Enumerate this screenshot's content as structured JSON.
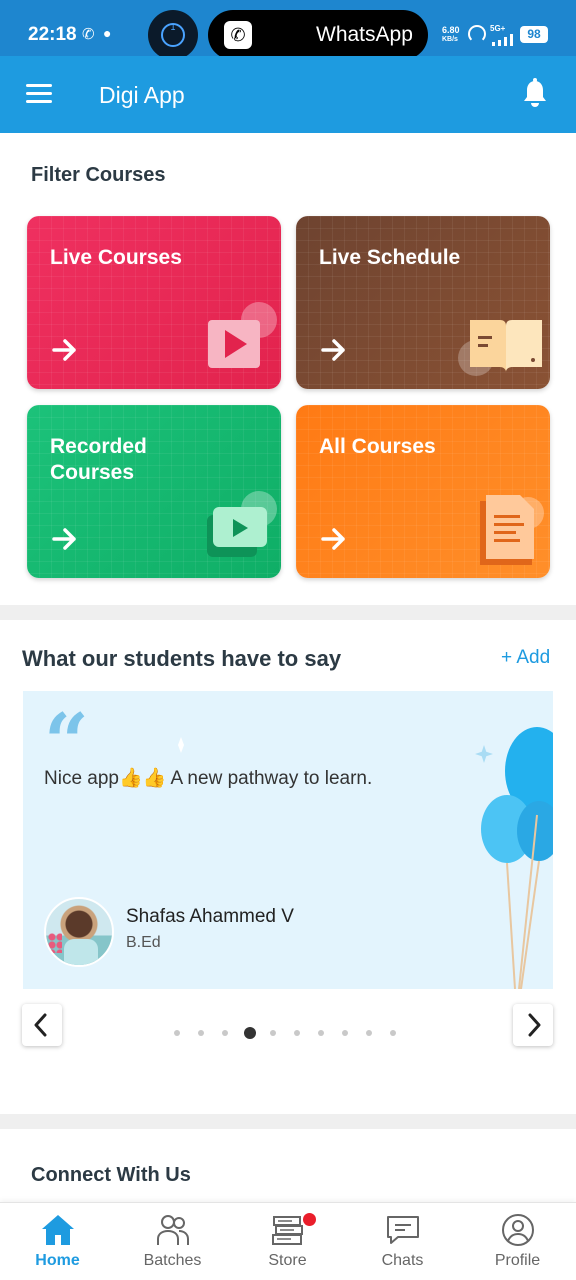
{
  "status_bar": {
    "time": "22:18",
    "call_counter": "1",
    "call_app": "WhatsApp",
    "speed_value": "6.80",
    "speed_unit": "KB/s",
    "network": "5G+",
    "battery": "98"
  },
  "app_bar": {
    "title": "Digi App"
  },
  "filter": {
    "title": "Filter Courses",
    "cards": [
      {
        "label": "Live Courses",
        "color": "#e92858"
      },
      {
        "label": "Live Schedule",
        "color": "#7a4a33"
      },
      {
        "label": "Recorded Courses",
        "color": "#14b870"
      },
      {
        "label": "All Courses",
        "color": "#ff8320"
      }
    ]
  },
  "testimonials": {
    "title": "What our students have to say",
    "add_label": "+ Add",
    "quote": "Nice app👍👍 A new pathway to learn.",
    "author_name": "Shafas Ahammed V",
    "author_degree": "B.Ed",
    "pagination": {
      "total": 10,
      "active": 4
    }
  },
  "connect": {
    "title": "Connect With Us"
  },
  "bottom_nav": {
    "items": [
      {
        "label": "Home",
        "icon": "home-icon",
        "active": true
      },
      {
        "label": "Batches",
        "icon": "batches-icon",
        "active": false
      },
      {
        "label": "Store",
        "icon": "store-icon",
        "active": false
      },
      {
        "label": "Chats",
        "icon": "chats-icon",
        "active": false
      },
      {
        "label": "Profile",
        "icon": "profile-icon",
        "active": false
      }
    ]
  },
  "colors": {
    "primary": "#1e9be0",
    "status_bar": "#1e86cf",
    "notification_badge": "#ea1e2b"
  }
}
